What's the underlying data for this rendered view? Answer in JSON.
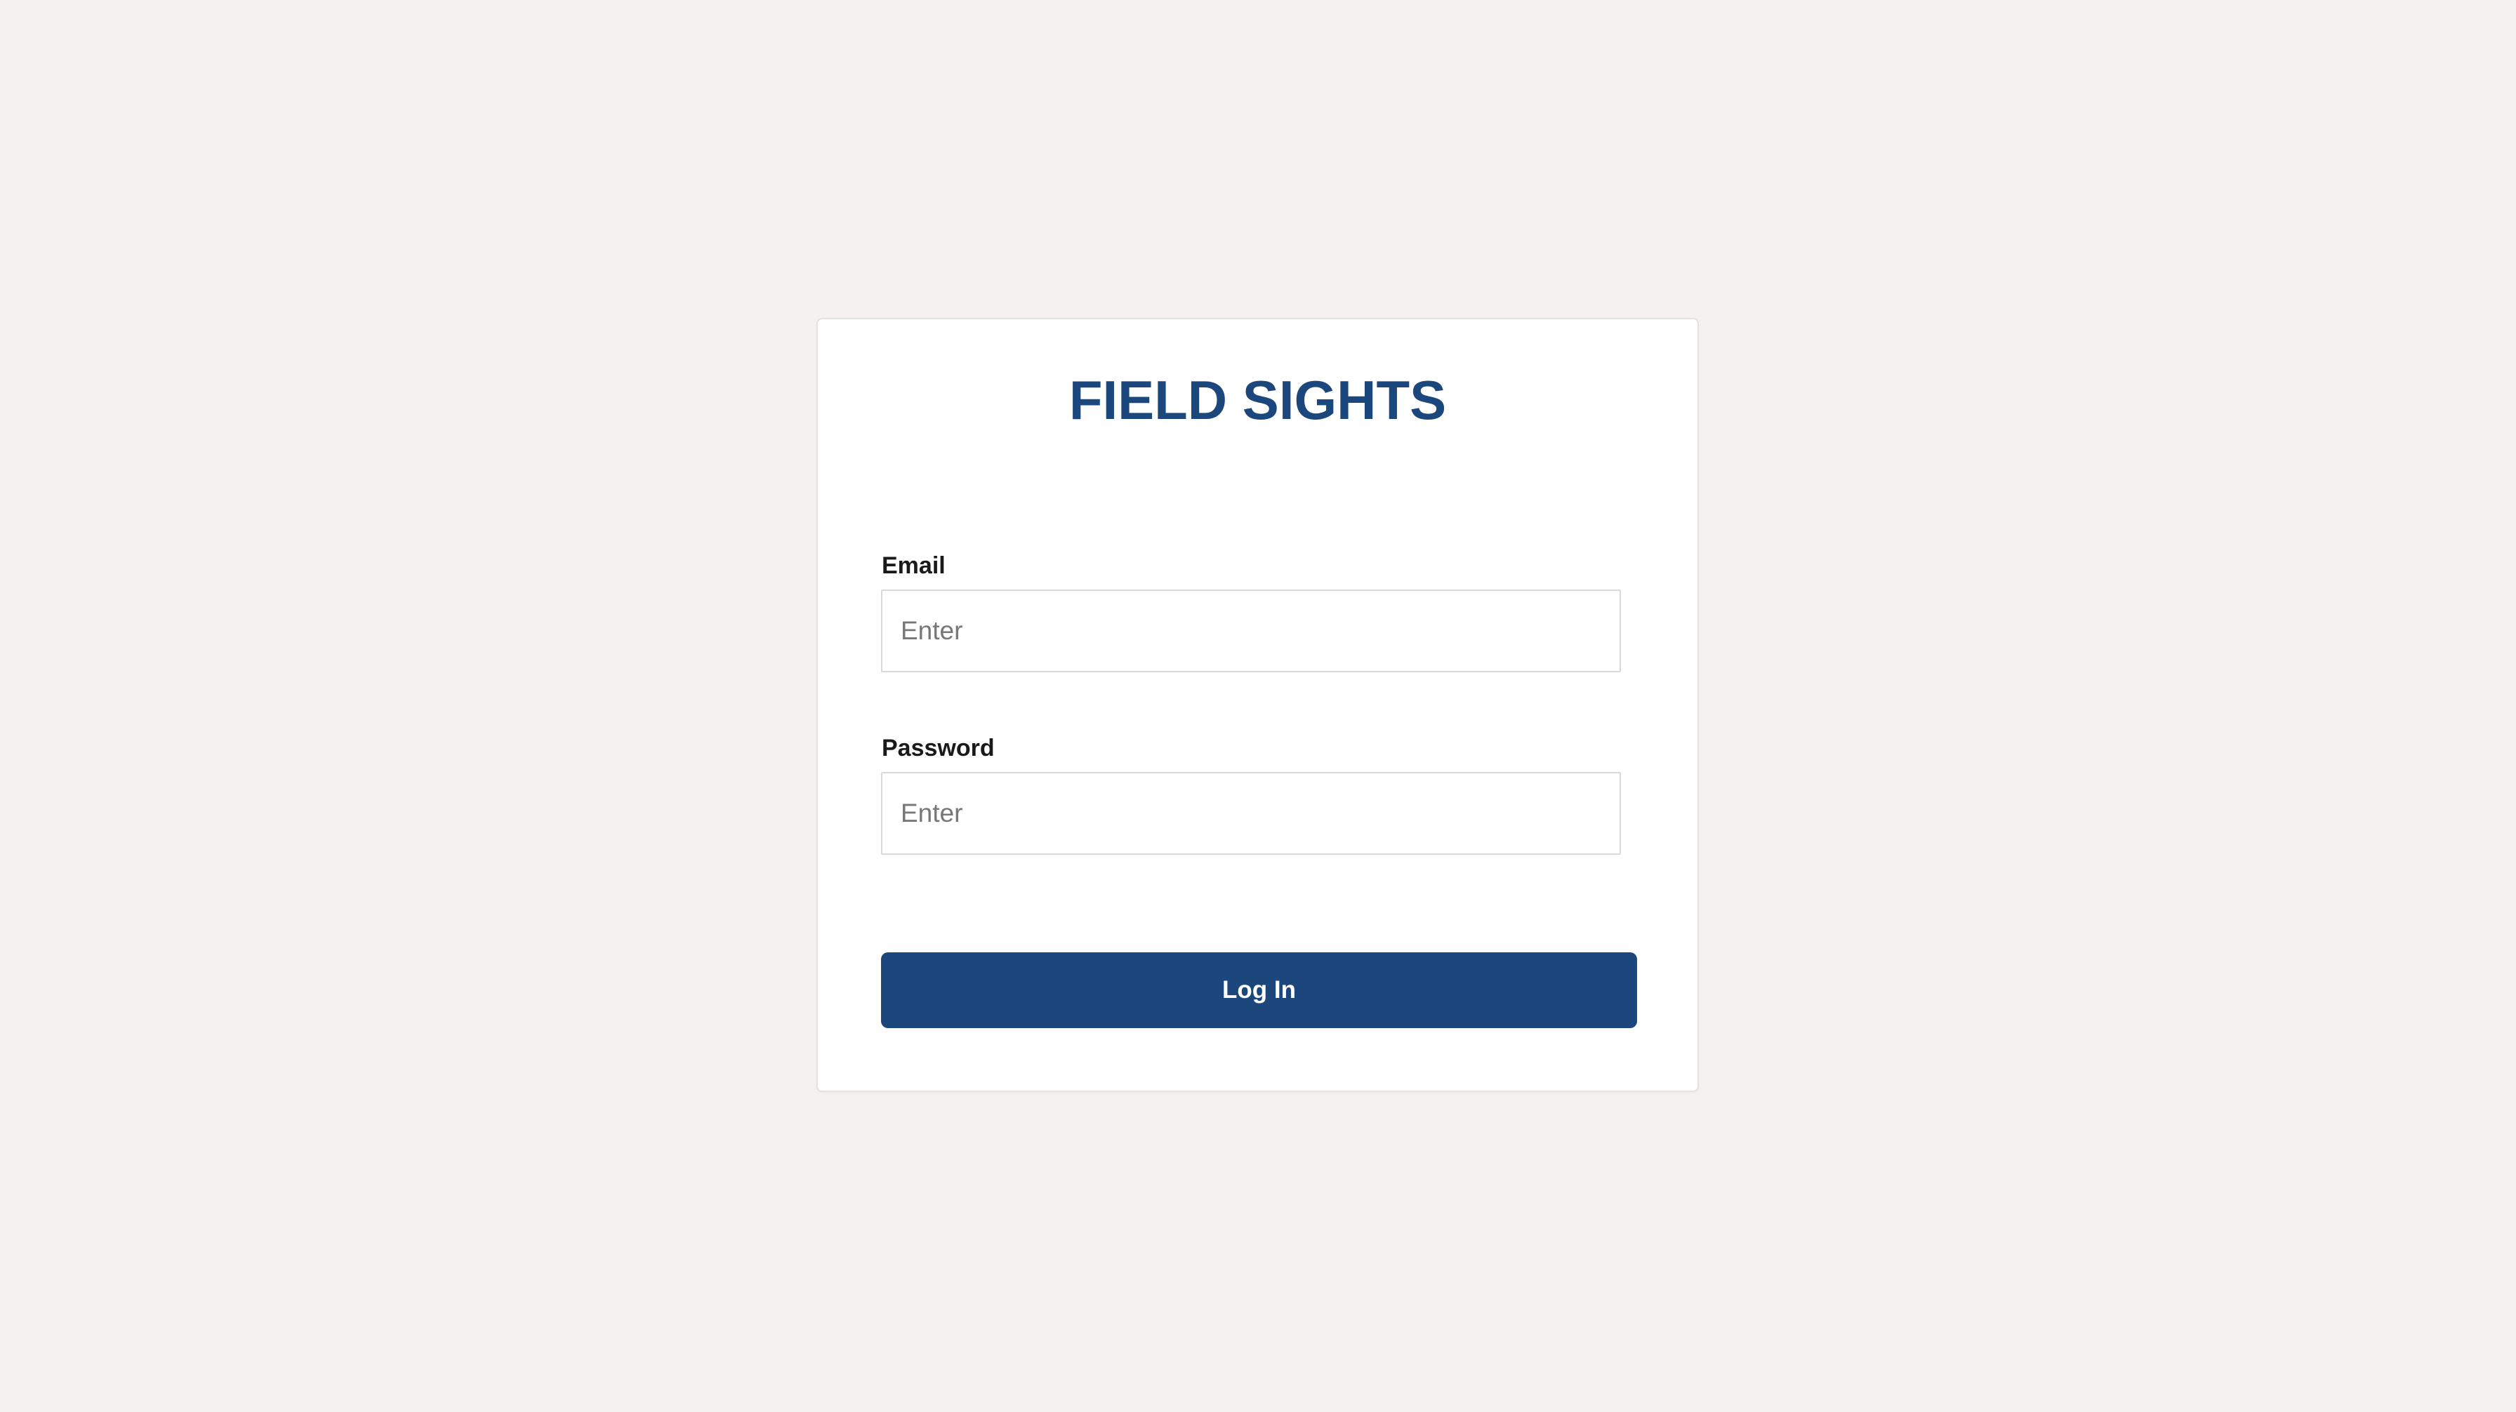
{
  "app": {
    "title": "FIELD SIGHTS"
  },
  "form": {
    "email": {
      "label": "Email",
      "placeholder": "Enter",
      "value": ""
    },
    "password": {
      "label": "Password",
      "placeholder": "Enter",
      "value": ""
    },
    "submit_label": "Log In"
  },
  "colors": {
    "background": "#f5f1ee",
    "card": "#ffffff",
    "brand": "#1b477d",
    "label_text": "#1a1a1a",
    "placeholder_text": "#777777",
    "input_border": "#d9d9d9"
  }
}
